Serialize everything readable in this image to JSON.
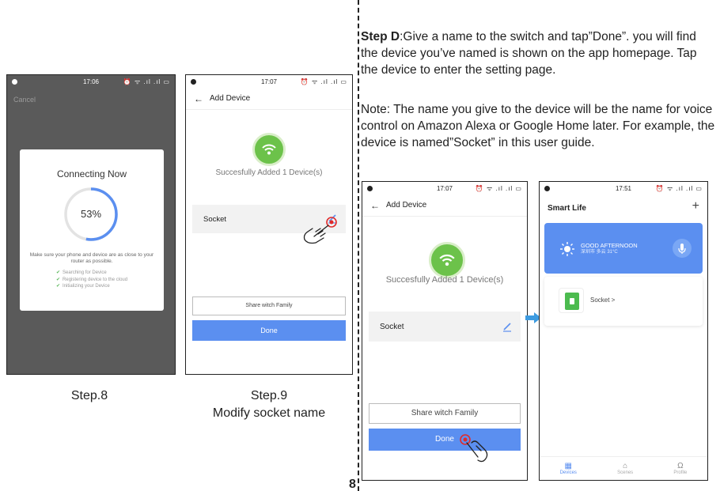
{
  "phone1": {
    "time": "17:06",
    "status_icons": "⏰ ᯤ .ıl .ıl ▭",
    "cancel": "Cancel",
    "dialog_title": "Connecting Now",
    "progress_text": "53%",
    "progress": 0.53,
    "hint": "Make sure your phone and device are as close to your router as possible.",
    "checks": [
      "Searching for Device",
      "Registering device to the cloud",
      "Initializing your Device"
    ]
  },
  "phone2": {
    "time": "17:07",
    "status_icons": "⏰ ᯤ .ıl .ıl ▭",
    "nav_back": "←",
    "nav_title": "Add Device",
    "success": "Succesfully Added 1 Device(s)",
    "device_name": "Socket",
    "share": "Share witch Family",
    "done": "Done"
  },
  "phone3": {
    "time": "17:07",
    "status_icons": "⏰ ᯤ .ıl .ıl ▭",
    "nav_back": "←",
    "nav_title": "Add Device",
    "success": "Succesfully Added 1 Device(s)",
    "device_name": "Socket",
    "share": "Share witch Family",
    "done": "Done"
  },
  "phone4": {
    "time": "17:51",
    "status_icons": "⏰ ᯤ .ıl .ıl ▭",
    "title": "Smart Life",
    "plus": "+",
    "weather_main": "GOOD AFTERNOON",
    "weather_sub": "深圳市 多云 31°C",
    "device_label": "Socket >",
    "tabs": [
      "Devices",
      "Scenes",
      "Profile"
    ]
  },
  "captions": {
    "step8": "Step.8",
    "step9_line1": "Step.9",
    "step9_line2": "Modify socket name"
  },
  "step_d": {
    "label": "Step D",
    "text": ":Give a name to the switch and tap”Done”. you will find the device you’ve named is shown on the app homepage. Tap the device to enter the setting page."
  },
  "note": "Note: The name you give to the device will be the name for voice control on Amazon Alexa or Google Home later. For example, the device is named”Socket” in this user guide.",
  "page_number": "8",
  "colors": {
    "accent_blue": "#5b8ff0",
    "success_green": "#6cc24a",
    "device_green": "#4cbb4f",
    "dark_screen": "#5a5a5a",
    "arrow_blue": "#3d9be0",
    "tap_red": "#e02b2b"
  }
}
